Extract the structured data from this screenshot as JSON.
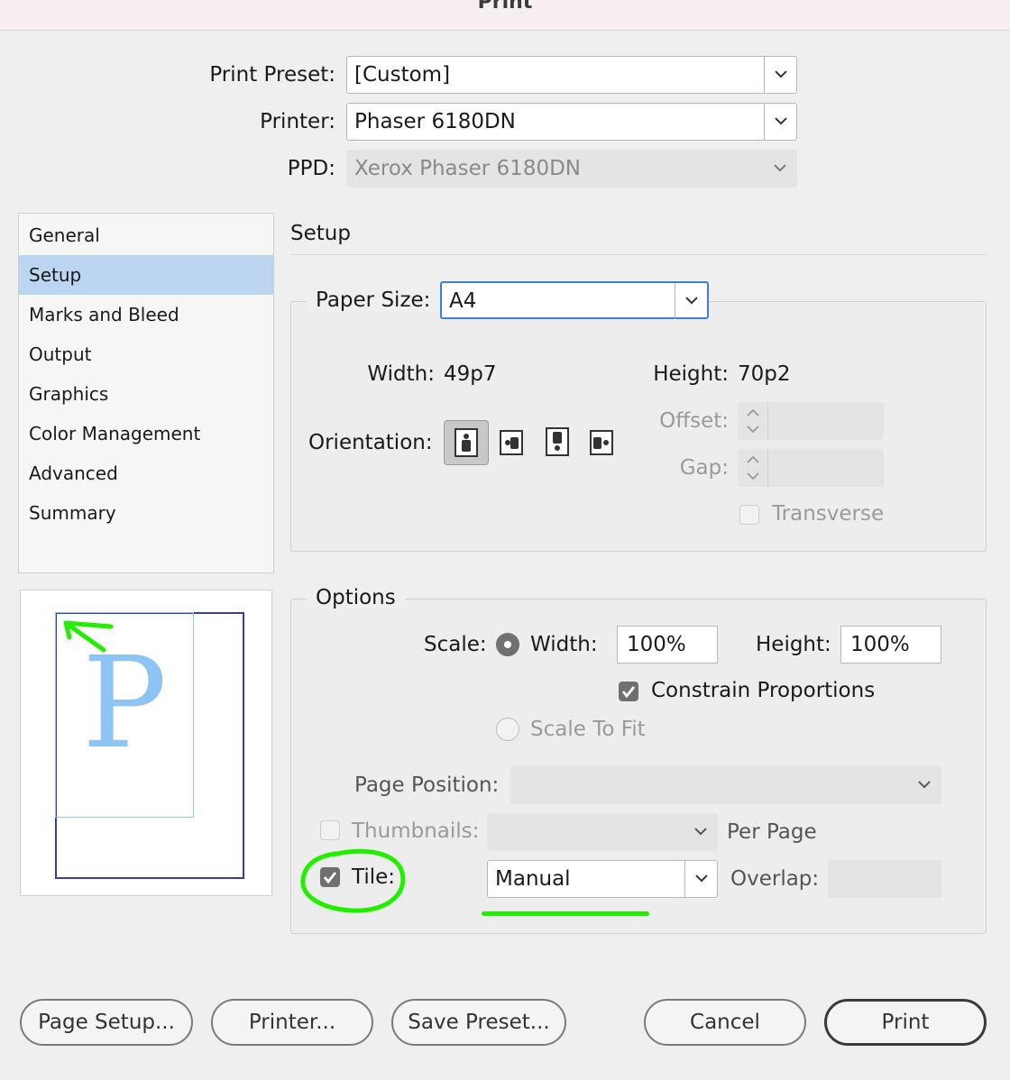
{
  "window": {
    "title": "Print"
  },
  "top": {
    "preset_label": "Print Preset:",
    "preset_value": "[Custom]",
    "printer_label": "Printer:",
    "printer_value": "Phaser 6180DN",
    "ppd_label": "PPD:",
    "ppd_value": "Xerox Phaser 6180DN"
  },
  "sidebar": {
    "items": [
      {
        "label": "General"
      },
      {
        "label": "Setup"
      },
      {
        "label": "Marks and Bleed"
      },
      {
        "label": "Output"
      },
      {
        "label": "Graphics"
      },
      {
        "label": "Color Management"
      },
      {
        "label": "Advanced"
      },
      {
        "label": "Summary"
      }
    ],
    "selected": "Setup"
  },
  "preview": {
    "letter": "P"
  },
  "setup": {
    "heading": "Setup",
    "paper_size_label": "Paper Size:",
    "paper_size_value": "A4",
    "width_label": "Width:",
    "width_value": "49p7",
    "height_label": "Height:",
    "height_value": "70p2",
    "orientation_label": "Orientation:",
    "orientation_selected": "portrait",
    "offset_label": "Offset:",
    "gap_label": "Gap:",
    "transverse_label": "Transverse"
  },
  "options": {
    "heading": "Options",
    "scale_label": "Scale:",
    "width_label": "Width:",
    "width_value": "100%",
    "height_label": "Height:",
    "height_value": "100%",
    "constrain_label": "Constrain Proportions",
    "constrain_checked": true,
    "scale_to_fit_label": "Scale To Fit",
    "page_position_label": "Page Position:",
    "thumbnails_label": "Thumbnails:",
    "per_page_label": "Per Page",
    "tile_label": "Tile:",
    "tile_checked": true,
    "tile_value": "Manual",
    "overlap_label": "Overlap:"
  },
  "buttons": {
    "page_setup": "Page Setup...",
    "printer": "Printer...",
    "save_preset": "Save Preset...",
    "cancel": "Cancel",
    "print": "Print"
  },
  "colors": {
    "selection": "#bcd5f0",
    "annotation_green": "#22ee00",
    "preview_page": "#8ec4f4",
    "preview_paper": "#3a3aa8"
  }
}
